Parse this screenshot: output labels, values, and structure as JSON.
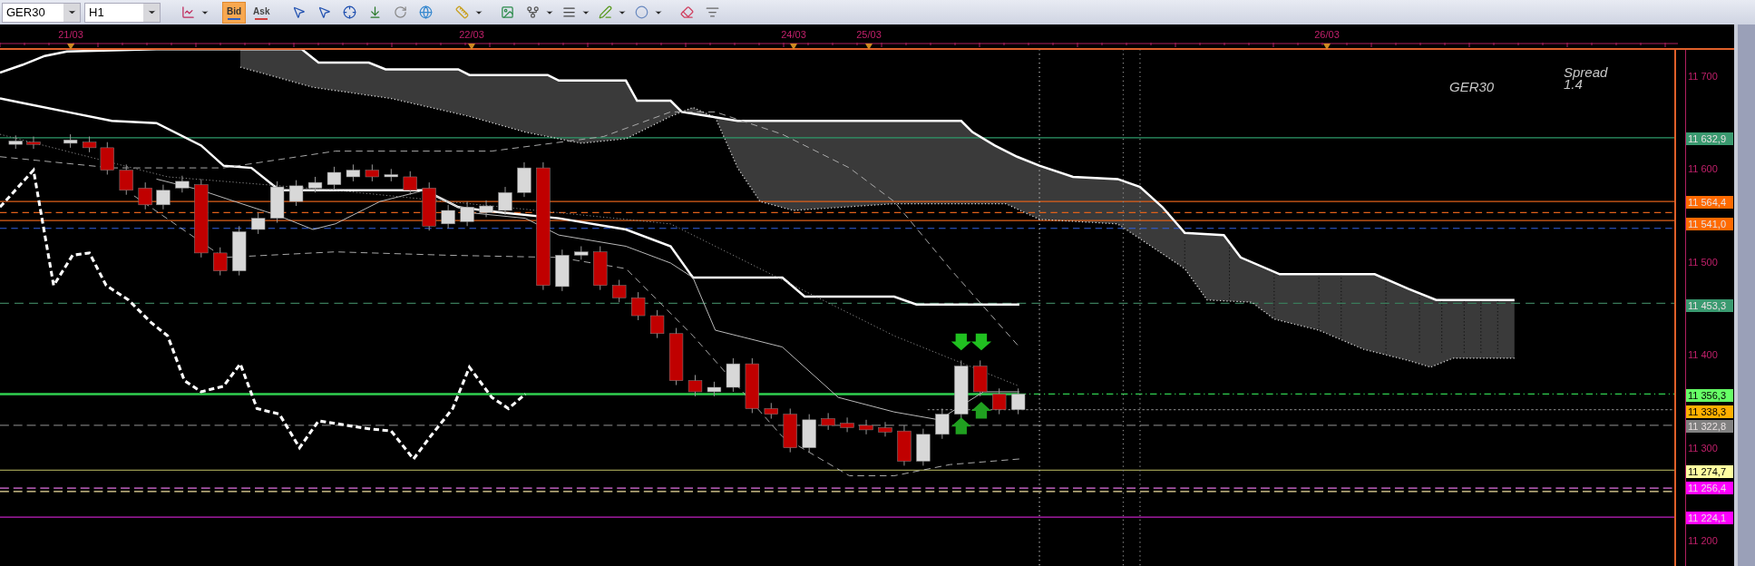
{
  "toolbar": {
    "symbol": "GER30",
    "timeframe": "H1",
    "price_tabs": [
      {
        "label": "Bid",
        "selected": true
      },
      {
        "label": "Ask",
        "selected": false
      }
    ]
  },
  "date_axis": {
    "labels": [
      "21/03",
      "22/03",
      "24/03",
      "25/03",
      "26/03"
    ]
  },
  "chart": {
    "symbol": "GER30",
    "spread_label": "Spread",
    "spread_value": "1.4"
  },
  "price_axis": {
    "ticks": [
      "11 700",
      "11 600",
      "11 500",
      "11 400",
      "11 300",
      "11 200"
    ],
    "price_labels": [
      {
        "text": "11 632,9",
        "color": "#3a9a70"
      },
      {
        "text": "11 564,4",
        "color": "#ff6a00"
      },
      {
        "text": "11 541,0",
        "color": "#ff6a00"
      },
      {
        "text": "11 453,3",
        "color": "#3a9a70"
      },
      {
        "text": "11 356,3",
        "color": "#66ff66"
      },
      {
        "text": "11 338,3",
        "color": "#ffb000"
      },
      {
        "text": "11 322,8",
        "color": "#808080"
      },
      {
        "text": "11 274,7",
        "color": "#ffffa0"
      },
      {
        "text": "11 256,4",
        "color": "#ff00ff"
      },
      {
        "text": "11 224,1",
        "color": "#ff00ff"
      }
    ]
  }
}
